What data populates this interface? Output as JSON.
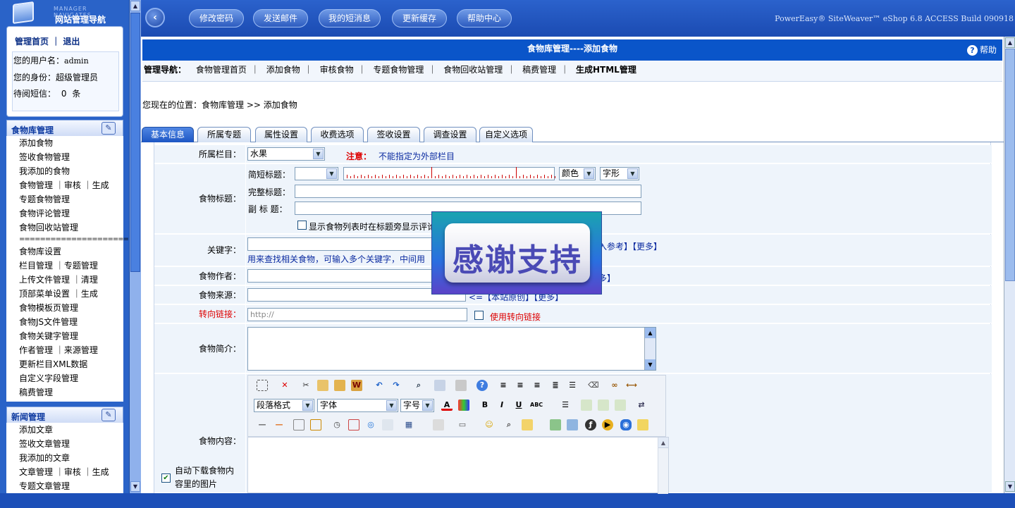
{
  "left": {
    "logo_en": "MANAGER NAVIGATES",
    "logo_cn": "网站管理导航",
    "home_link": "管理首页",
    "logout_link": "退出",
    "username_label": "您的用户名：",
    "username": "admin",
    "role_label": "您的身份：",
    "role": "超级管理员",
    "pending_label": "待阅短信：",
    "pending_count": "0",
    "pending_unit": "条",
    "sections": [
      {
        "title": "食物库管理",
        "items": [
          "添加食物",
          "签收食物管理",
          "我添加的食物",
          "食物管理 ｜审核 ｜生成",
          "专题食物管理",
          "食物评论管理",
          "食物回收站管理",
          "=====================",
          "食物库设置",
          "栏目管理 ｜专题管理",
          "上传文件管理 ｜清理",
          "顶部菜单设置 ｜生成",
          "食物模板页管理",
          "食物JS文件管理",
          "食物关键字管理",
          "作者管理 ｜来源管理",
          "更新栏目XML数据",
          "自定义字段管理",
          "稿费管理"
        ]
      },
      {
        "title": "新闻管理",
        "items": [
          "添加文章",
          "签收文章管理",
          "我添加的文章",
          "文章管理 ｜审核 ｜生成",
          "专题文章管理"
        ]
      }
    ]
  },
  "top": {
    "buttons": [
      "修改密码",
      "发送邮件",
      "我的短消息",
      "更新缓存",
      "帮助中心"
    ],
    "version": "PowerEasy® SiteWeaver™ eShop 6.8 ACCESS Build 090918"
  },
  "main": {
    "title": "食物库管理----添加食物",
    "help": "帮助",
    "nav_label": "管理导航：",
    "nav_items": [
      "食物管理首页",
      "添加食物",
      "审核食物",
      "专题食物管理",
      "食物回收站管理",
      "稿费管理",
      "生成HTML管理"
    ],
    "location": "您现在的位置：食物库管理 >> 添加食物",
    "tabs": [
      "基本信息",
      "所属专题",
      "属性设置",
      "收费选项",
      "签收设置",
      "调查设置",
      "自定义选项"
    ]
  },
  "form": {
    "category_label": "所属栏目：",
    "category_value": "水果",
    "category_note_label": "注意：",
    "category_note": "不能指定为外部栏目",
    "title_label": "食物标题：",
    "short_title_label": "简短标题：",
    "color_label": "颜色",
    "font_label": "字形",
    "full_title_label": "完整标题：",
    "subtitle_label": "副 标 题：",
    "show_comment": "显示食物列表时在标题旁显示评论",
    "keyword_label": "关键字：",
    "keyword_links": "入参考】【更多】",
    "keyword_hint": "用来查找相关食物，可输入多个关键字，中间用",
    "author_label": "食物作者：",
    "author_links": "多】",
    "source_label": "食物来源：",
    "source_links": "<=【本站原创】【更多】",
    "redirect_label": "转向链接：",
    "redirect_placeholder": "http://",
    "redirect_check": "使用转向链接",
    "intro_label": "食物简介：",
    "content_label": "食物内容：",
    "autodownload": "自动下载食物内容里的图片",
    "para_format": "段落格式",
    "font_family": "字体",
    "font_size": "字号"
  },
  "overlay": {
    "text": "感谢支持"
  },
  "colors": {
    "nav_bg": "#1c4fb8",
    "header_blue": "#0a55c9",
    "field_bg": "#eef4fb",
    "red": "#dd0000"
  }
}
